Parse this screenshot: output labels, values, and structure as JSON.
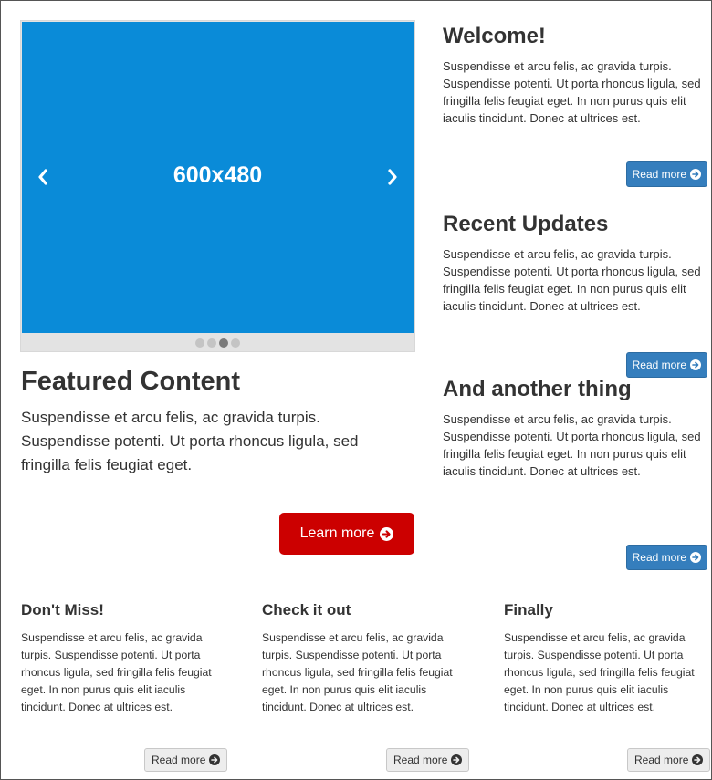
{
  "carousel": {
    "caption": "600x480",
    "slide_color": "#0a8bd8",
    "indicators": [
      {
        "active": false
      },
      {
        "active": false
      },
      {
        "active": true
      },
      {
        "active": false
      }
    ],
    "prev_icon": "chevron-left-icon",
    "next_icon": "chevron-right-icon"
  },
  "sidebar": {
    "blocks": [
      {
        "title": "Welcome!",
        "text": "Suspendisse et arcu felis, ac gravida turpis. Suspendisse potenti. Ut porta rhoncus ligula, sed fringilla felis feugiat eget. In non purus quis elit iaculis tincidunt. Donec at ultrices est.",
        "button": "Read more"
      },
      {
        "title": "Recent Updates",
        "text": "Suspendisse et arcu felis, ac gravida turpis. Suspendisse potenti. Ut porta rhoncus ligula, sed fringilla felis feugiat eget. In non purus quis elit iaculis tincidunt. Donec at ultrices est.",
        "button": "Read more"
      },
      {
        "title": "And another thing",
        "text": "Suspendisse et arcu felis, ac gravida turpis. Suspendisse potenti. Ut porta rhoncus ligula, sed fringilla felis feugiat eget. In non purus quis elit iaculis tincidunt. Donec at ultrices est.",
        "button": "Read more"
      }
    ],
    "button_color": "#357ebd"
  },
  "featured": {
    "title": "Featured Content",
    "text": "Suspendisse et arcu felis, ac gravida turpis. Suspendisse potenti. Ut porta rhoncus ligula, sed fringilla felis feugiat eget.",
    "button": "Learn more",
    "button_color": "#cc0000"
  },
  "columns": [
    {
      "title": "Don't Miss!",
      "text": "Suspendisse et arcu felis, ac gravida turpis. Suspendisse potenti. Ut porta rhoncus ligula, sed fringilla felis feugiat eget. In non purus quis elit iaculis tincidunt. Donec at ultrices est.",
      "button": "Read more"
    },
    {
      "title": "Check it out",
      "text": "Suspendisse et arcu felis, ac gravida turpis. Suspendisse potenti. Ut porta rhoncus ligula, sed fringilla felis feugiat eget. In non purus quis elit iaculis tincidunt. Donec at ultrices est.",
      "button": "Read more"
    },
    {
      "title": "Finally",
      "text": "Suspendisse et arcu felis, ac gravida turpis. Suspendisse potenti. Ut porta rhoncus ligula, sed fringilla felis feugiat eget. In non purus quis elit iaculis tincidunt. Donec at ultrices est.",
      "button": "Read more"
    }
  ],
  "icons": {
    "button_icon": "circle-arrow-right-icon"
  }
}
